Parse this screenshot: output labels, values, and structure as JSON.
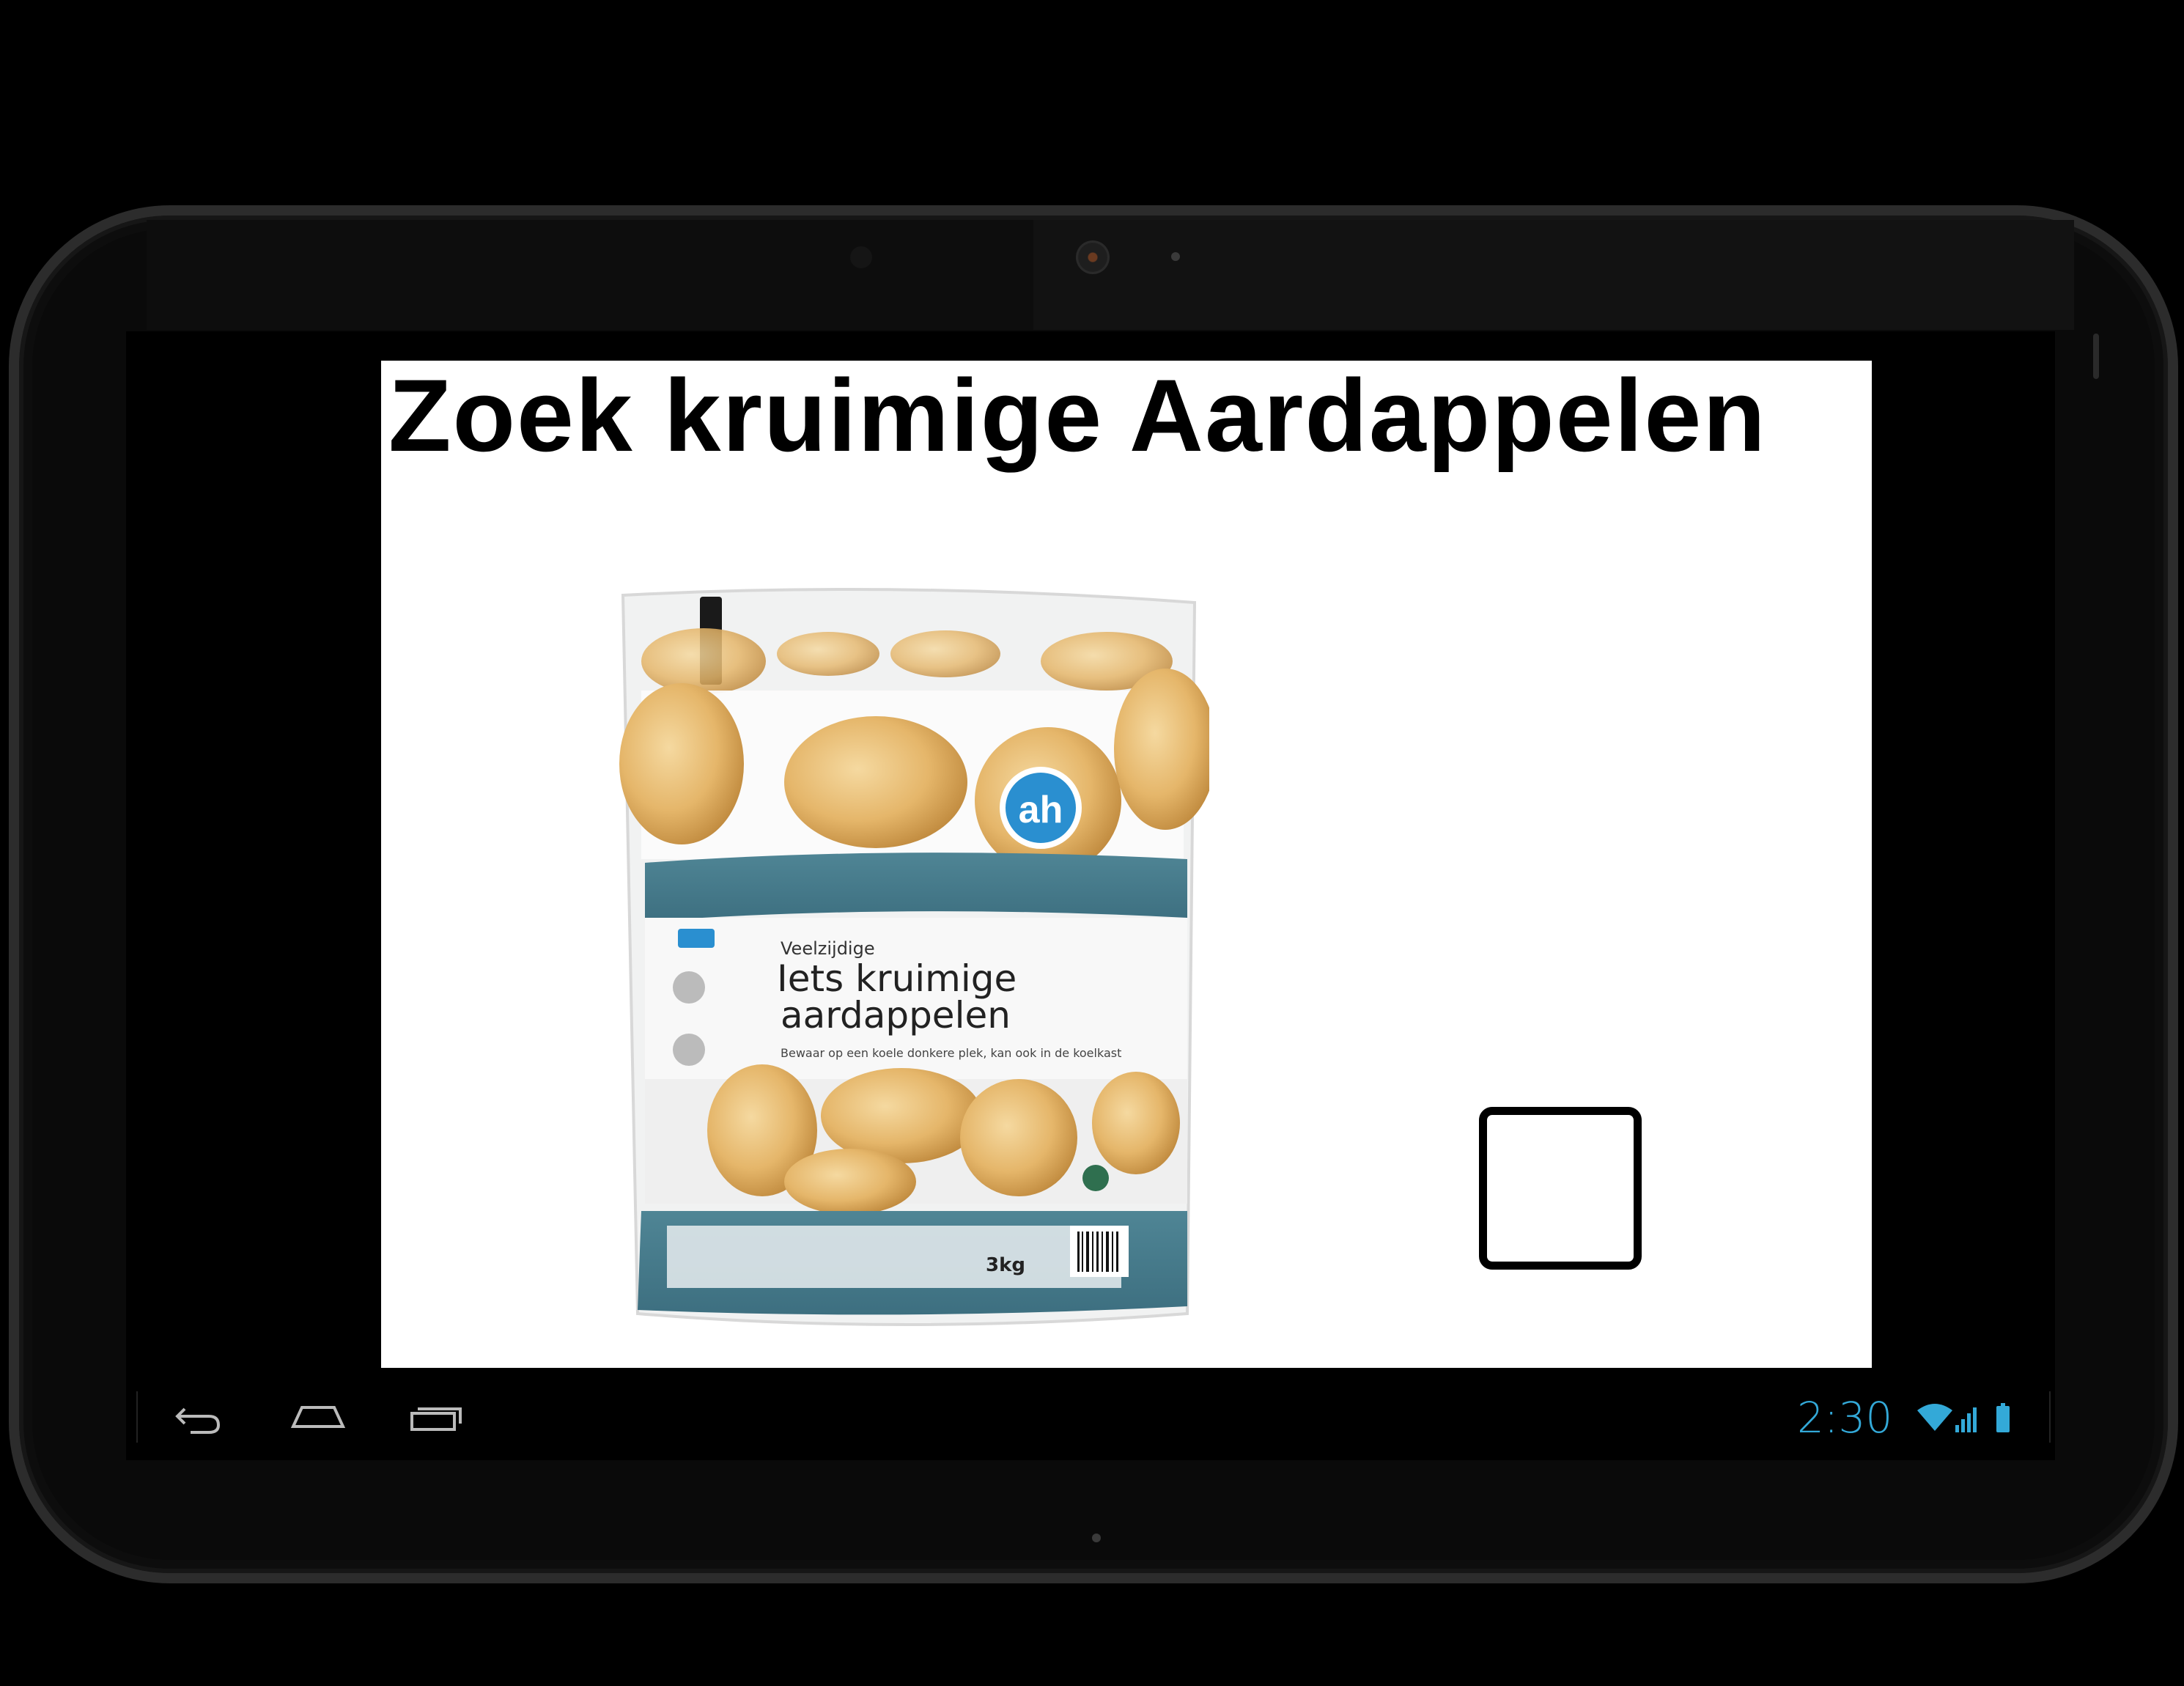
{
  "app": {
    "title": "Zoek kruimige Aardappelen"
  },
  "product": {
    "image_name": "potato-bag-image",
    "brand_logo": "ah",
    "label_small": "Veelzijdige",
    "label_line1": "Iets kruimige",
    "label_line2": "aardappelen",
    "storage_note": "Bewaar op een koele donkere plek, kan ook in de koelkast",
    "weight": "3kg"
  },
  "checkbox": {
    "checked": false
  },
  "system_bar": {
    "time": "2:30",
    "icons": [
      "back-icon",
      "home-icon",
      "recent-apps-icon",
      "wifi-icon",
      "signal-icon",
      "battery-icon"
    ],
    "accent_color": "#33a9d8"
  }
}
